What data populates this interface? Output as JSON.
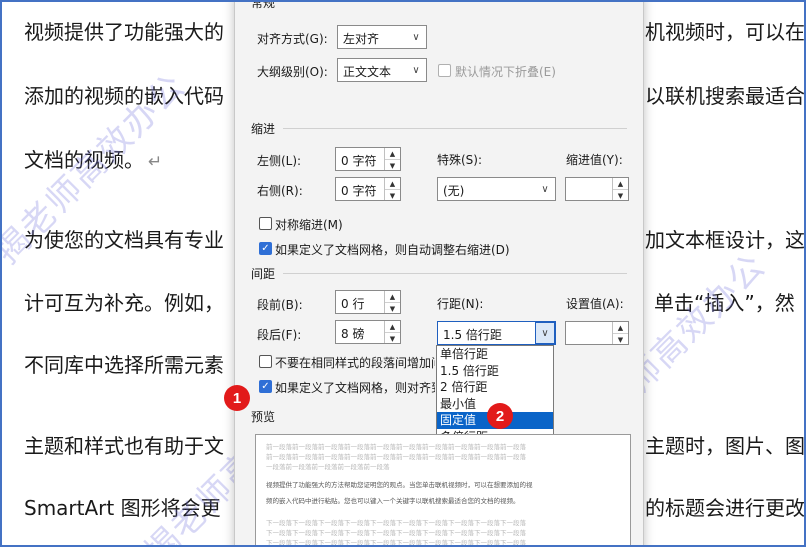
{
  "background_doc": {
    "left_lines": [
      "视频提供了功能强大的",
      "添加的视频的嵌入代码",
      "文档的视频。",
      "为使您的文档具有专业",
      "计可互为补充。例如，",
      "不同库中选择所需元素",
      "主题和样式也有助于文",
      "SmartArt 图形将会更"
    ],
    "right_lines": [
      "机视频时，可以在",
      "以联机搜索最适合",
      "加文本框设计，这",
      "单击“插入”，然",
      "主题时，图片、图",
      "的标题会进行更改"
    ],
    "return_mark": "↵",
    "watermark": "揭老师高效办公"
  },
  "dialog": {
    "general_header": "常规",
    "alignment_label": "对齐方式(G):",
    "alignment_value": "左对齐",
    "outline_label": "大纲级别(O):",
    "outline_value": "正文文本",
    "collapse_label": "默认情况下折叠(E)",
    "indent_header": "缩进",
    "left_label": "左侧(L):",
    "left_value": "0 字符",
    "right_label": "右侧(R):",
    "right_value": "0 字符",
    "special_label": "特殊(S):",
    "special_value": "(无)",
    "indent_by_label": "缩进值(Y):",
    "mirror_label": "对称缩进(M)",
    "auto_indent_label": "如果定义了文档网格，则自动调整右缩进(D)",
    "spacing_header": "间距",
    "before_label": "段前(B):",
    "before_value": "0 行",
    "after_label": "段后(F):",
    "after_value": "8 磅",
    "line_spacing_label": "行距(N):",
    "line_spacing_value": "1.5 倍行距",
    "at_label": "设置值(A):",
    "no_space_label": "不要在相同样式的段落间增加间",
    "snap_grid_label": "如果定义了文档网格，则对齐到",
    "preview_header": "预览"
  },
  "dropdown": {
    "options": [
      "单倍行距",
      "1.5 倍行距",
      "2 倍行距",
      "最小值",
      "固定值",
      "多倍行距"
    ],
    "highlighted": "固定值"
  },
  "preview": {
    "prev_line": "前一段落前一段落前一段落前一段落前一段落前一段落前一段落前一段落前一段落前一段落",
    "prev_short": "一段落前一段落前一段落前一段落前一段落",
    "sample_1": "视频提供了功能强大的方法帮助您证明您的观点。当您单击联机视频时，可以在想要添加的视",
    "sample_2": "频的嵌入代码中进行粘贴。您也可以键入一个关键字以联机搜索最适合您的文档的视频。",
    "next_line": "下一段落下一段落下一段落下一段落下一段落下一段落下一段落下一段落下一段落下一段落"
  },
  "badges": [
    "1",
    "2"
  ],
  "colors": {
    "frame": "#4472c4",
    "highlight": "#0a64c8",
    "badge": "#e21a1a",
    "checkbox": "#2f6fd6"
  }
}
